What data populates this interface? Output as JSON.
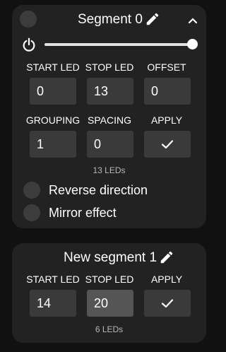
{
  "segment0": {
    "title": "Segment 0",
    "labels": [
      "START LED",
      "STOP LED",
      "OFFSET"
    ],
    "labels2": [
      "GROUPING",
      "SPACING",
      "APPLY"
    ],
    "start_led": "0",
    "stop_led": "13",
    "offset": "0",
    "grouping": "1",
    "spacing": "0",
    "brightness": 1.0,
    "led_count": "13 LEDs",
    "reverse_label": "Reverse direction",
    "mirror_label": "Mirror effect"
  },
  "segment1": {
    "title": "New segment 1",
    "labels": [
      "START LED",
      "STOP LED",
      "APPLY"
    ],
    "start_led": "14",
    "stop_led": "20",
    "led_count": "6 LEDs"
  },
  "icons": {
    "select": "circle-check-icon",
    "edit": "pencil-icon",
    "collapse": "chevron-up-icon",
    "power": "power-icon",
    "apply": "checkmark-icon"
  }
}
